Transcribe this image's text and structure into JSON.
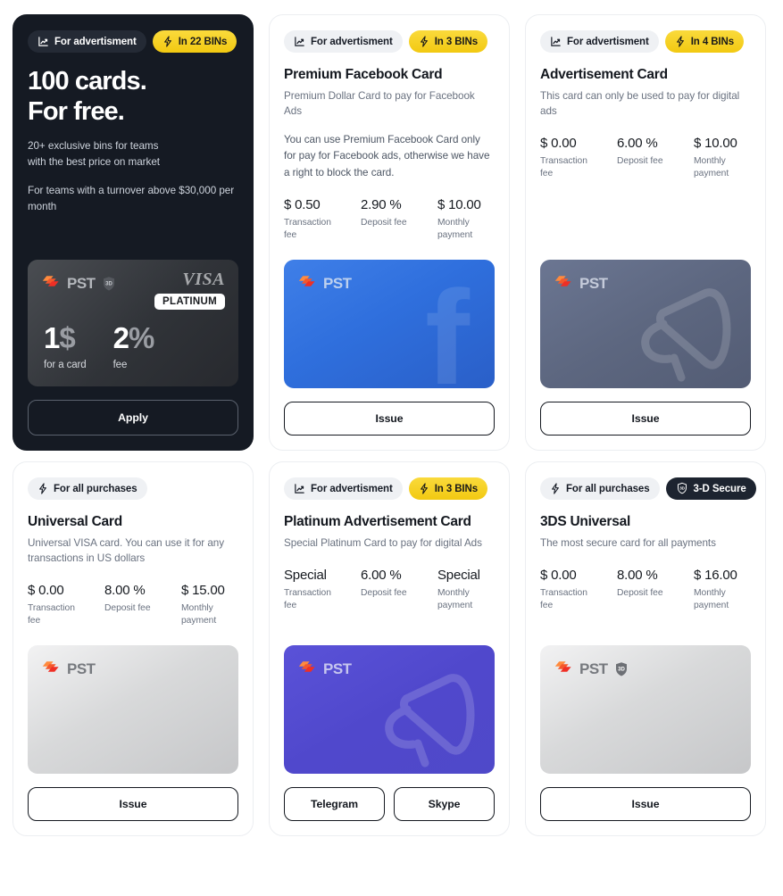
{
  "cards": [
    {
      "theme": "dark",
      "badges": [
        {
          "label": "For advertisment",
          "style": "grey",
          "icon": "chart-line-icon"
        },
        {
          "label": "In 22 BINs",
          "style": "yellow",
          "icon": "lightning-bolt-icon"
        }
      ],
      "hero_title_line1": "100 cards.",
      "hero_title_line2": "For free.",
      "hero_sub_line1": "20+ exclusive bins for teams",
      "hero_sub_line2": "with the best price on market",
      "hero_sub_2": "For teams with a turnover above $30,000 per month",
      "plastic": {
        "brand": "PST",
        "has_3d_shield": true,
        "visa_word": "VISA",
        "platinum_label": "PLATINUM",
        "stats": [
          {
            "value": "1",
            "unit": "$",
            "label": "for a card"
          },
          {
            "value": "2",
            "unit": "%",
            "label": "fee"
          }
        ]
      },
      "actions": [
        {
          "label": "Apply"
        }
      ]
    },
    {
      "theme": "light",
      "badges": [
        {
          "label": "For advertisment",
          "style": "grey",
          "icon": "chart-line-icon"
        },
        {
          "label": "In 3 BINs",
          "style": "yellow",
          "icon": "lightning-bolt-icon"
        }
      ],
      "title": "Premium Facebook Card",
      "subtitle": "Premium Dollar Card to pay for Facebook Ads",
      "note": "You can use Premium Facebook Card only for pay for Facebook ads, otherwise we have a right to block the card.",
      "fees": [
        {
          "value": "$ 0.50",
          "label": "Transaction fee"
        },
        {
          "value": "2.90 %",
          "label": "Deposit fee"
        },
        {
          "value": "$ 10.00",
          "label": "Monthly payment"
        }
      ],
      "plastic": {
        "brand": "PST",
        "variant": "blue",
        "watermark": "facebook-f-icon"
      },
      "actions": [
        {
          "label": "Issue"
        }
      ]
    },
    {
      "theme": "light",
      "badges": [
        {
          "label": "For advertisment",
          "style": "grey",
          "icon": "chart-line-icon"
        },
        {
          "label": "In 4 BINs",
          "style": "yellow",
          "icon": "lightning-bolt-icon"
        }
      ],
      "title": "Advertisement Card",
      "subtitle": "This card can only be used to pay for digital ads",
      "fees": [
        {
          "value": "$ 0.00",
          "label": "Transaction fee"
        },
        {
          "value": "6.00 %",
          "label": "Deposit fee"
        },
        {
          "value": "$ 10.00",
          "label": "Monthly payment"
        }
      ],
      "plastic": {
        "brand": "PST",
        "variant": "slate",
        "watermark": "megaphone-icon"
      },
      "actions": [
        {
          "label": "Issue"
        }
      ]
    },
    {
      "theme": "light",
      "badges": [
        {
          "label": "For all purchases",
          "style": "grey",
          "icon": "lightning-bolt-icon"
        }
      ],
      "title": "Universal Card",
      "subtitle": "Universal VISA card. You can use it for any transactions in US dollars",
      "fees": [
        {
          "value": "$ 0.00",
          "label": "Transaction fee"
        },
        {
          "value": "8.00 %",
          "label": "Deposit fee"
        },
        {
          "value": "$ 15.00",
          "label": "Monthly payment"
        }
      ],
      "plastic": {
        "brand": "PST",
        "variant": "silver"
      },
      "actions": [
        {
          "label": "Issue"
        }
      ]
    },
    {
      "theme": "light",
      "badges": [
        {
          "label": "For advertisment",
          "style": "grey",
          "icon": "chart-line-icon"
        },
        {
          "label": "In 3 BINs",
          "style": "yellow",
          "icon": "lightning-bolt-icon"
        }
      ],
      "title": "Platinum Advertisement Card",
      "subtitle": "Special Platinum Card to pay for digital Ads",
      "fees": [
        {
          "value": "Special",
          "label": "Transaction fee"
        },
        {
          "value": "6.00 %",
          "label": "Deposit fee"
        },
        {
          "value": "Special",
          "label": "Monthly payment"
        }
      ],
      "plastic": {
        "brand": "PST",
        "variant": "purple",
        "watermark": "megaphone-icon"
      },
      "actions": [
        {
          "label": "Telegram"
        },
        {
          "label": "Skype"
        }
      ]
    },
    {
      "theme": "light",
      "badges": [
        {
          "label": "For all purchases",
          "style": "grey",
          "icon": "lightning-bolt-icon"
        },
        {
          "label": "3-D Secure",
          "style": "dark",
          "icon": "shield-3d-icon"
        }
      ],
      "title": "3DS Universal",
      "subtitle": "The most secure card for all payments",
      "fees": [
        {
          "value": "$ 0.00",
          "label": "Transaction fee"
        },
        {
          "value": "8.00 %",
          "label": "Deposit fee"
        },
        {
          "value": "$ 16.00",
          "label": "Monthly payment"
        }
      ],
      "plastic": {
        "brand": "PST",
        "variant": "silver",
        "has_3d_shield": true
      },
      "actions": [
        {
          "label": "Issue"
        }
      ]
    }
  ],
  "colors": {
    "accent_yellow": "#f2c911",
    "dark": "#151a23",
    "blue_card": "#2f6fdd",
    "purple_card": "#5048cc",
    "slate_card": "#5d6780",
    "pst_orange": "#ff7a2f",
    "pst_red": "#f0392b"
  }
}
